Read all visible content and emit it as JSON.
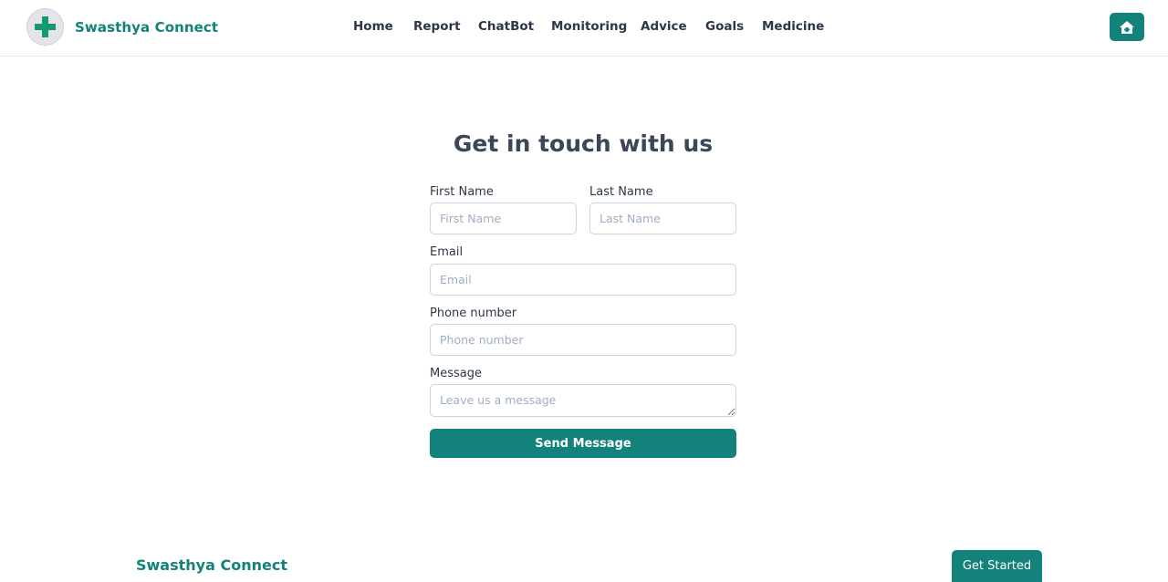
{
  "brand": {
    "name": "Swasthya Connect",
    "logo_icon": "medical-cross-icon",
    "accent_color": "#13827a"
  },
  "nav": {
    "items": [
      "Home",
      "Report",
      "ChatBot",
      "Monitoring",
      "Advice",
      "Goals",
      "Medicine"
    ],
    "home_icon": "house-icon"
  },
  "form": {
    "title": "Get in touch with us",
    "first_name": {
      "label": "First Name",
      "placeholder": "First Name"
    },
    "last_name": {
      "label": "Last Name",
      "placeholder": "Last Name"
    },
    "email": {
      "label": "Email",
      "placeholder": "Email"
    },
    "phone": {
      "label": "Phone number",
      "placeholder": "Phone number"
    },
    "message": {
      "label": "Message",
      "placeholder": "Leave us a message"
    },
    "submit_label": "Send Message"
  },
  "footer": {
    "brand": "Swasthya Connect",
    "cta_label": "Get Started"
  }
}
